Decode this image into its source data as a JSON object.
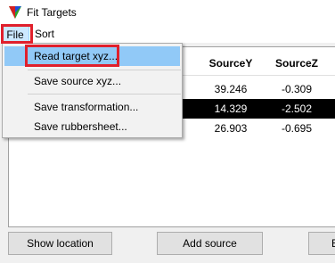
{
  "window": {
    "title": "Fit Targets"
  },
  "menubar": {
    "file_label": "File",
    "sort_label": "Sort"
  },
  "file_menu": {
    "items": [
      {
        "label": "Read target xyz..."
      },
      {
        "label": "Save source xyz..."
      },
      {
        "label": "Save transformation..."
      },
      {
        "label": "Save rubbersheet..."
      }
    ]
  },
  "table": {
    "headers": {
      "source_y": "SourceY",
      "source_z": "SourceZ"
    },
    "rows": [
      {
        "source_y": "39.246",
        "source_z": "-0.309"
      },
      {
        "source_y": "14.329",
        "source_z": "-2.502"
      },
      {
        "source_y": "26.903",
        "source_z": "-0.695"
      }
    ]
  },
  "buttons": {
    "show_location": "Show location",
    "add_source": "Add source",
    "partial": "E"
  },
  "colors": {
    "selected_row": "#000000",
    "menu_highlight": "#91c9f7",
    "annotation_box": "#e0202c"
  }
}
